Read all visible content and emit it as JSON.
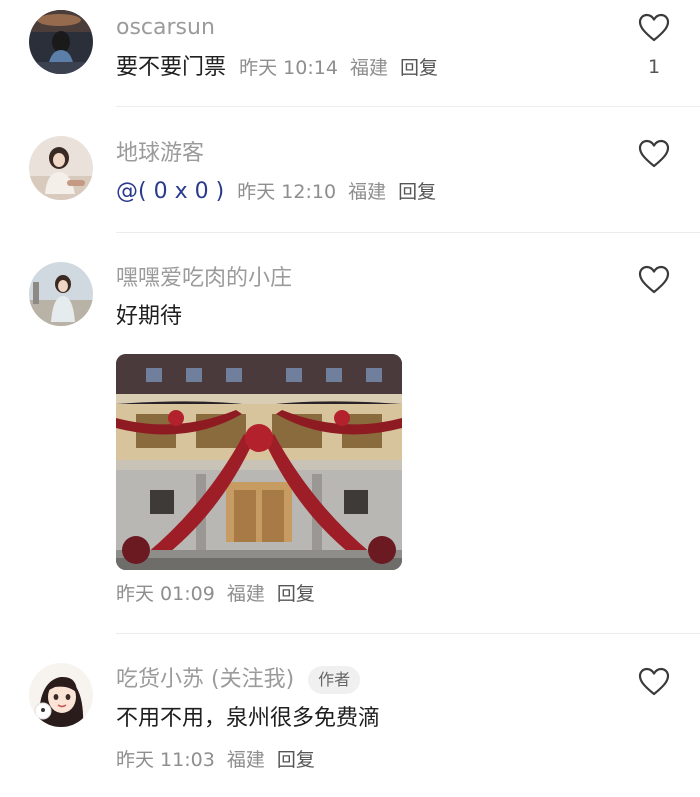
{
  "comments": [
    {
      "username": "oscarsun",
      "content": "要不要门票",
      "time": "昨天 10:14",
      "location": "福建",
      "reply": "回复",
      "likes": "1",
      "avatar_icon": "avatar-woman-night"
    },
    {
      "username": "地球游客",
      "content": "@( 0 x 0 )",
      "time": "昨天 12:10",
      "location": "福建",
      "reply": "回复",
      "avatar_icon": "avatar-girl-sitting"
    },
    {
      "username": "嘿嘿爱吃肉的小庄",
      "content": "好期待",
      "time": "昨天 01:09",
      "location": "福建",
      "reply": "回复",
      "avatar_icon": "avatar-girl-outdoor",
      "image_icon": "building-festive-photo"
    },
    {
      "username": "吃货小苏 (关注我)",
      "badge": "作者",
      "content": "不用不用，泉州很多免费滴",
      "time": "昨天 11:03",
      "location": "福建",
      "reply": "回复",
      "avatar_icon": "avatar-cartoon-girl"
    }
  ],
  "colors": {
    "username": "#9b9b9b",
    "meta": "#8e8e8e",
    "divider": "#ececec",
    "badge_bg": "#f0f0f0"
  }
}
